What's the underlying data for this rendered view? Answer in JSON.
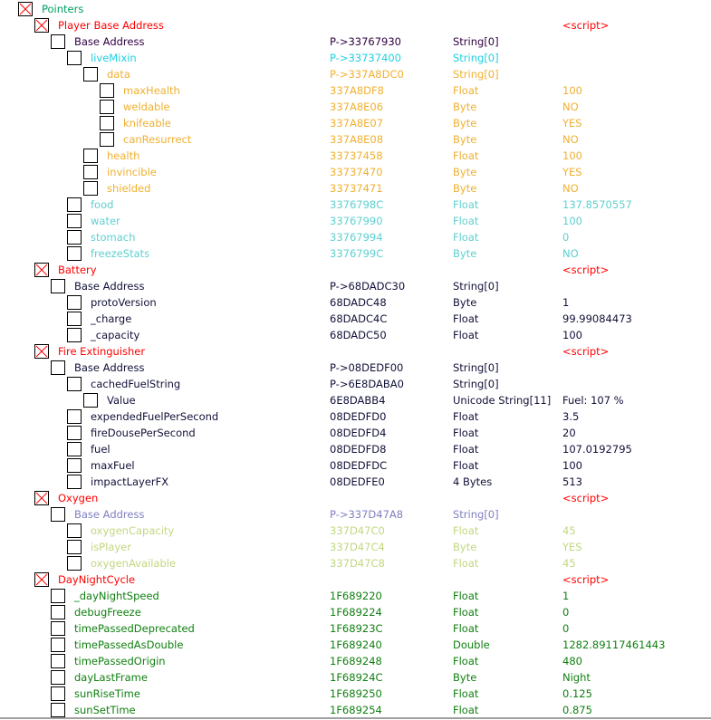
{
  "colors": {
    "root": "#00a060",
    "group": "#ff0000",
    "player_base": "#300040",
    "live_mixin": "#20d0e0",
    "data": "#f0b030",
    "player_stats": "#60d0d0",
    "normal": "#101038",
    "oxygen_base": "#8080c0",
    "oxygen_fields": "#c0d880",
    "day_night": "#108010"
  },
  "rows": [
    {
      "level": 0,
      "checked": true,
      "desc": "Pointers",
      "addr": "",
      "type": "",
      "value": "",
      "color": "root"
    },
    {
      "level": 1,
      "checked": true,
      "desc": "Player Base Address",
      "addr": "",
      "type": "",
      "value": "<script>",
      "color": "group"
    },
    {
      "level": 2,
      "checked": false,
      "desc": "Base Address",
      "addr": "P->33767930",
      "type": "String[0]",
      "value": "",
      "color": "player_base"
    },
    {
      "level": 3,
      "checked": false,
      "desc": "liveMixin",
      "addr": "P->33737400",
      "type": "String[0]",
      "value": "",
      "color": "live_mixin"
    },
    {
      "level": 4,
      "checked": false,
      "desc": "data",
      "addr": "P->337A8DC0",
      "type": "String[0]",
      "value": "",
      "color": "data"
    },
    {
      "level": 5,
      "checked": false,
      "desc": "maxHealth",
      "addr": "337A8DF8",
      "type": "Float",
      "value": "100",
      "color": "data"
    },
    {
      "level": 5,
      "checked": false,
      "desc": "weldable",
      "addr": "337A8E06",
      "type": "Byte",
      "value": "NO",
      "color": "data"
    },
    {
      "level": 5,
      "checked": false,
      "desc": "knifeable",
      "addr": "337A8E07",
      "type": "Byte",
      "value": "YES",
      "color": "data"
    },
    {
      "level": 5,
      "checked": false,
      "desc": "canResurrect",
      "addr": "337A8E08",
      "type": "Byte",
      "value": "NO",
      "color": "data"
    },
    {
      "level": 4,
      "checked": false,
      "desc": "health",
      "addr": "33737458",
      "type": "Float",
      "value": "100",
      "color": "data"
    },
    {
      "level": 4,
      "checked": false,
      "desc": "invincible",
      "addr": "33737470",
      "type": "Byte",
      "value": "YES",
      "color": "data"
    },
    {
      "level": 4,
      "checked": false,
      "desc": "shielded",
      "addr": "33737471",
      "type": "Byte",
      "value": "NO",
      "color": "data"
    },
    {
      "level": 3,
      "checked": false,
      "desc": "food",
      "addr": "3376798C",
      "type": "Float",
      "value": "137.8570557",
      "color": "player_stats"
    },
    {
      "level": 3,
      "checked": false,
      "desc": "water",
      "addr": "33767990",
      "type": "Float",
      "value": "100",
      "color": "player_stats"
    },
    {
      "level": 3,
      "checked": false,
      "desc": "stomach",
      "addr": "33767994",
      "type": "Float",
      "value": "0",
      "color": "player_stats"
    },
    {
      "level": 3,
      "checked": false,
      "desc": "freezeStats",
      "addr": "3376799C",
      "type": "Byte",
      "value": "NO",
      "color": "player_stats"
    },
    {
      "level": 1,
      "checked": true,
      "desc": "Battery",
      "addr": "",
      "type": "",
      "value": "<script>",
      "color": "group"
    },
    {
      "level": 2,
      "checked": false,
      "desc": "Base Address",
      "addr": "P->68DADC30",
      "type": "String[0]",
      "value": "",
      "color": "normal"
    },
    {
      "level": 3,
      "checked": false,
      "desc": "protoVersion",
      "addr": "68DADC48",
      "type": "Byte",
      "value": "1",
      "color": "normal"
    },
    {
      "level": 3,
      "checked": false,
      "desc": "_charge",
      "addr": "68DADC4C",
      "type": "Float",
      "value": "99.99084473",
      "color": "normal"
    },
    {
      "level": 3,
      "checked": false,
      "desc": "_capacity",
      "addr": "68DADC50",
      "type": "Float",
      "value": "100",
      "color": "normal"
    },
    {
      "level": 1,
      "checked": true,
      "desc": "Fire Extinguisher",
      "addr": "",
      "type": "",
      "value": "<script>",
      "color": "group"
    },
    {
      "level": 2,
      "checked": false,
      "desc": "Base Address",
      "addr": "P->08DEDF00",
      "type": "String[0]",
      "value": "",
      "color": "normal"
    },
    {
      "level": 3,
      "checked": false,
      "desc": "cachedFuelString",
      "addr": "P->6E8DABA0",
      "type": "String[0]",
      "value": "",
      "color": "normal"
    },
    {
      "level": 4,
      "checked": false,
      "desc": "Value",
      "addr": "6E8DABB4",
      "type": "Unicode String[11]",
      "value": "Fuel: 107 %",
      "color": "normal"
    },
    {
      "level": 3,
      "checked": false,
      "desc": "expendedFuelPerSecond",
      "addr": "08DEDFD0",
      "type": "Float",
      "value": "3.5",
      "color": "normal"
    },
    {
      "level": 3,
      "checked": false,
      "desc": "fireDousePerSecond",
      "addr": "08DEDFD4",
      "type": "Float",
      "value": "20",
      "color": "normal"
    },
    {
      "level": 3,
      "checked": false,
      "desc": "fuel",
      "addr": "08DEDFD8",
      "type": "Float",
      "value": "107.0192795",
      "color": "normal"
    },
    {
      "level": 3,
      "checked": false,
      "desc": "maxFuel",
      "addr": "08DEDFDC",
      "type": "Float",
      "value": "100",
      "color": "normal"
    },
    {
      "level": 3,
      "checked": false,
      "desc": "impactLayerFX",
      "addr": "08DEDFE0",
      "type": "4 Bytes",
      "value": "513",
      "color": "normal"
    },
    {
      "level": 1,
      "checked": true,
      "desc": "Oxygen",
      "addr": "",
      "type": "",
      "value": "<script>",
      "color": "group"
    },
    {
      "level": 2,
      "checked": false,
      "desc": "Base Address",
      "addr": "P->337D47A8",
      "type": "String[0]",
      "value": "",
      "color": "oxygen_base"
    },
    {
      "level": 3,
      "checked": false,
      "desc": "oxygenCapacity",
      "addr": "337D47C0",
      "type": "Float",
      "value": "45",
      "color": "oxygen_fields"
    },
    {
      "level": 3,
      "checked": false,
      "desc": "isPlayer",
      "addr": "337D47C4",
      "type": "Byte",
      "value": " YES",
      "color": "oxygen_fields"
    },
    {
      "level": 3,
      "checked": false,
      "desc": "oxygenAvailable",
      "addr": "337D47C8",
      "type": "Float",
      "value": "45",
      "color": "oxygen_fields"
    },
    {
      "level": 1,
      "checked": true,
      "desc": "DayNightCycle",
      "addr": "",
      "type": "",
      "value": "<script>",
      "color": "group"
    },
    {
      "level": 2,
      "checked": false,
      "desc": "_dayNightSpeed",
      "addr": "1F689220",
      "type": "Float",
      "value": "1",
      "color": "day_night"
    },
    {
      "level": 2,
      "checked": false,
      "desc": "debugFreeze",
      "addr": "1F689224",
      "type": "Float",
      "value": "0",
      "color": "day_night"
    },
    {
      "level": 2,
      "checked": false,
      "desc": "timePassedDeprecated",
      "addr": "1F68923C",
      "type": "Float",
      "value": "0",
      "color": "day_night"
    },
    {
      "level": 2,
      "checked": false,
      "desc": "timePassedAsDouble",
      "addr": "1F689240",
      "type": "Double",
      "value": "1282.89117461443",
      "color": "day_night"
    },
    {
      "level": 2,
      "checked": false,
      "desc": "timePassedOrigin",
      "addr": "1F689248",
      "type": "Float",
      "value": "480",
      "color": "day_night"
    },
    {
      "level": 2,
      "checked": false,
      "desc": "dayLastFrame",
      "addr": "1F68924C",
      "type": "Byte",
      "value": "Night",
      "color": "day_night"
    },
    {
      "level": 2,
      "checked": false,
      "desc": "sunRiseTime",
      "addr": "1F689250",
      "type": "Float",
      "value": "0.125",
      "color": "day_night"
    },
    {
      "level": 2,
      "checked": false,
      "desc": "sunSetTime",
      "addr": "1F689254",
      "type": "Float",
      "value": "0.875",
      "color": "day_night"
    }
  ]
}
